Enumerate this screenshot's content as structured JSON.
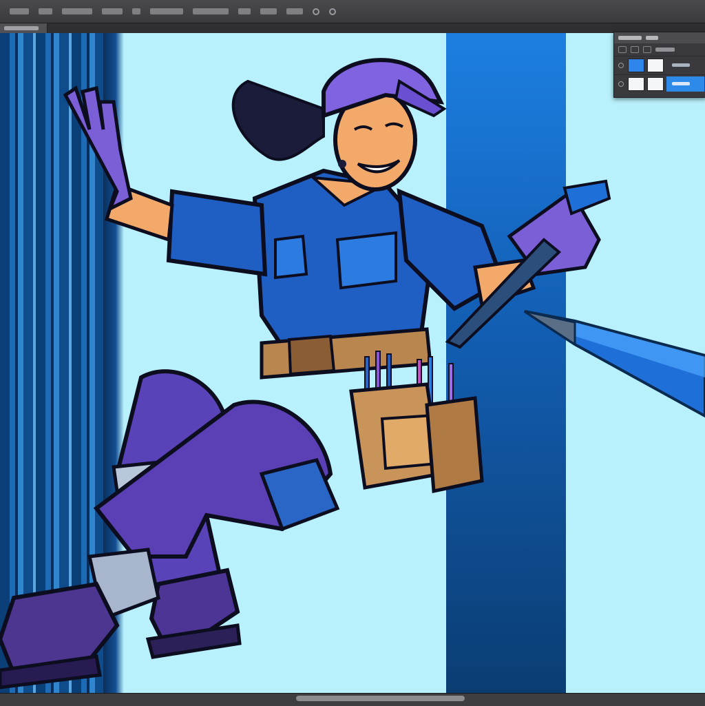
{
  "app": {
    "menu_items": [
      "",
      "",
      "",
      "",
      "",
      "",
      "",
      "",
      "",
      ""
    ]
  },
  "layers_panel": {
    "layers": [
      {
        "thumb_left": "blue",
        "thumb_right": "white",
        "selected": false
      },
      {
        "thumb_left": "white",
        "thumb_right": "white",
        "selected": true
      }
    ]
  },
  "canvas": {
    "background_color": "#b8f0fb",
    "stripe_colors": [
      "#0b3f78",
      "#1d6bb4",
      "#1361b8"
    ]
  },
  "artwork": {
    "subject": "",
    "colors": {
      "uniform": "#1f5fc4",
      "gloves": "#7a5fd6",
      "helmet": "#7f63e0",
      "tool_belt": "#b9864f",
      "skin": "#f2a96a",
      "boots": "#5b3f97"
    }
  }
}
